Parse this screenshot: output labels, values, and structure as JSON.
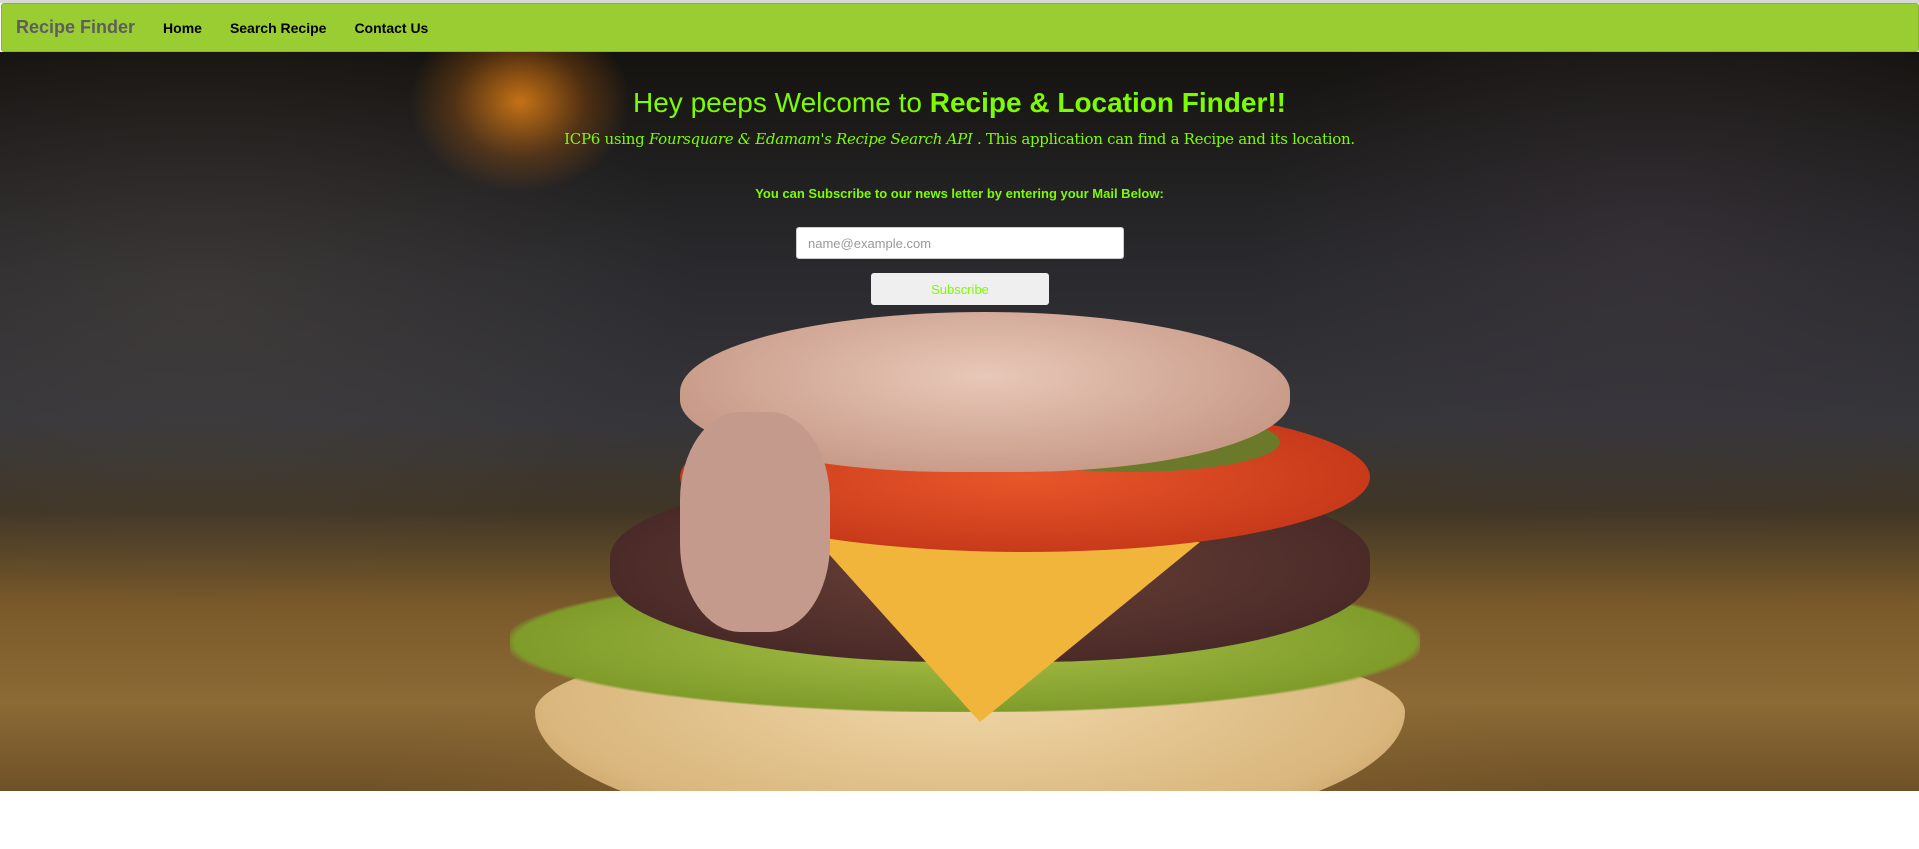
{
  "nav": {
    "brand": "Recipe Finder",
    "links": [
      "Home",
      "Search Recipe",
      "Contact Us"
    ]
  },
  "hero": {
    "heading_plain": "Hey peeps Welcome to ",
    "heading_bold": "Recipe & Location Finder!!",
    "sub_a": "ICP6 using ",
    "sub_italic": "Foursquare & Edamam's Recipe Search API",
    "sub_b": " . This application can find a Recipe and its location.",
    "subscribe_label": "You can Subscribe to our news letter by entering your Mail Below:",
    "email_placeholder": "name@example.com",
    "email_value": "",
    "subscribe_button": "Subscribe"
  },
  "colors": {
    "navbar": "#9acd32",
    "accent": "#7cfc00"
  }
}
